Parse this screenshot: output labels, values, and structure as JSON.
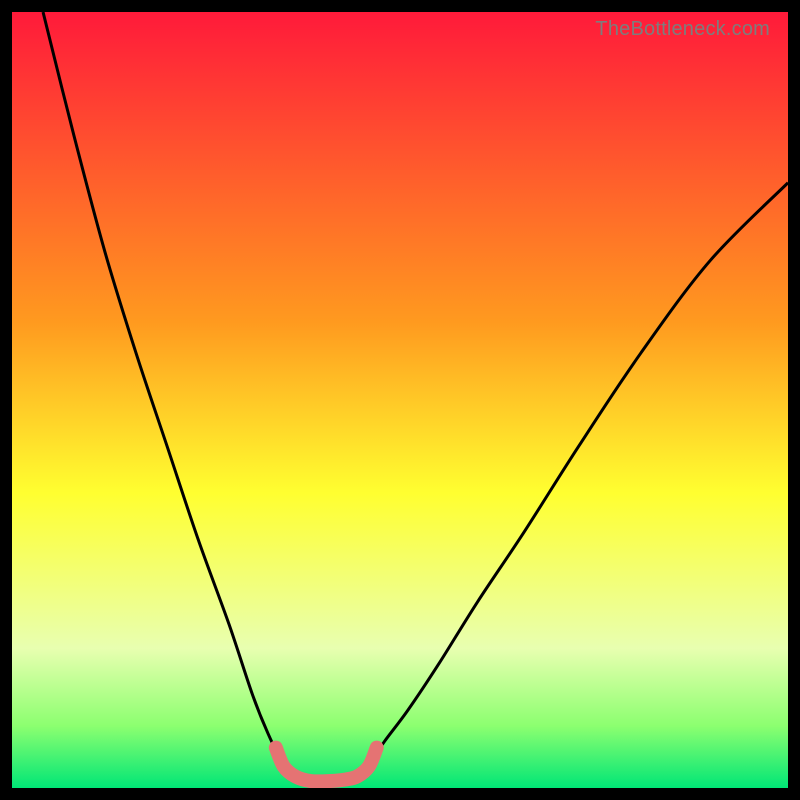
{
  "watermark": {
    "text": "TheBottleneck.com"
  },
  "colors": {
    "red": "#ff1a3a",
    "orange": "#ff9a1f",
    "yellow": "#ffff30",
    "green_pale": "#e8ffb0",
    "green_mid": "#8cff70",
    "green": "#00e676",
    "highlight": "#e57373",
    "curve": "#000000",
    "frame": "#000000"
  },
  "chart_data": {
    "type": "line",
    "title": "",
    "xlabel": "",
    "ylabel": "",
    "xlim": [
      0,
      100
    ],
    "ylim": [
      0,
      100
    ],
    "series": [
      {
        "name": "left-curve",
        "x": [
          4,
          8,
          12,
          16,
          20,
          24,
          28,
          31,
          33,
          35,
          36.5
        ],
        "values": [
          100,
          84,
          69,
          56,
          44,
          32,
          21,
          12,
          7,
          3,
          1.5
        ]
      },
      {
        "name": "right-curve",
        "x": [
          44.5,
          46,
          48,
          51,
          55,
          60,
          66,
          73,
          81,
          90,
          100
        ],
        "values": [
          1.5,
          3,
          6,
          10,
          16,
          24,
          33,
          44,
          56,
          68,
          78
        ]
      },
      {
        "name": "valley-highlight",
        "x": [
          34,
          35,
          36.5,
          38.5,
          41,
          43,
          44.5,
          46,
          47
        ],
        "values": [
          5.2,
          2.8,
          1.5,
          0.9,
          0.9,
          1.1,
          1.5,
          2.8,
          5.2
        ]
      }
    ],
    "gradient_stops": [
      {
        "pos": 0.0,
        "color": "red"
      },
      {
        "pos": 0.4,
        "color": "orange"
      },
      {
        "pos": 0.62,
        "color": "yellow"
      },
      {
        "pos": 0.82,
        "color": "green_pale"
      },
      {
        "pos": 0.92,
        "color": "green_mid"
      },
      {
        "pos": 1.0,
        "color": "green"
      }
    ]
  }
}
